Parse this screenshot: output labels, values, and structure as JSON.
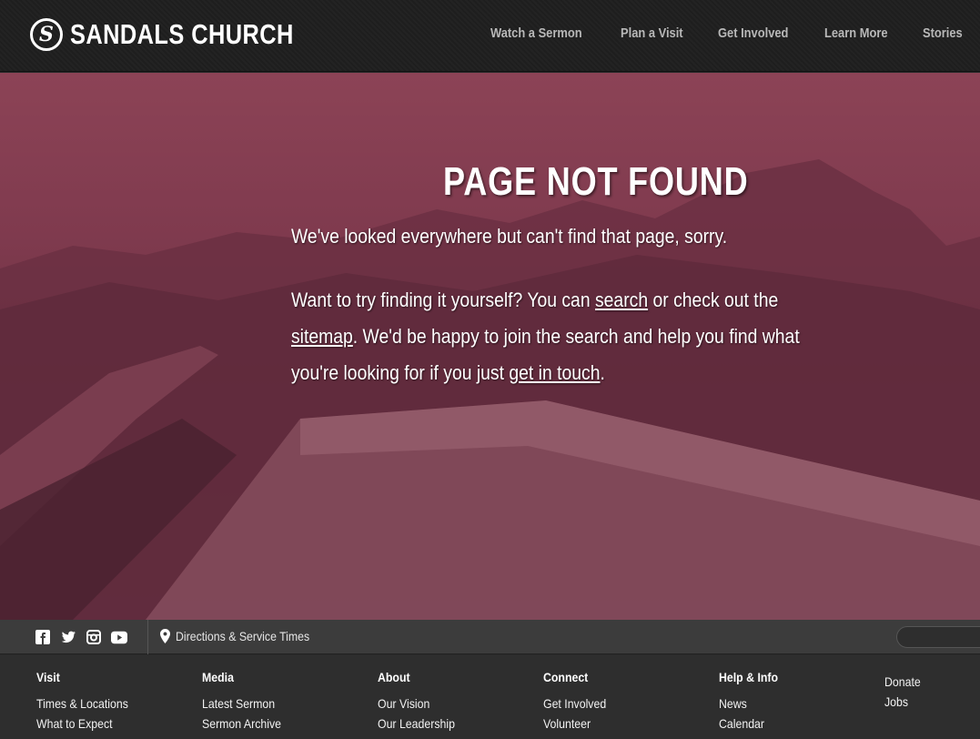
{
  "header": {
    "logo_text": "SANDALS CHURCH",
    "nav": [
      "Watch a Sermon",
      "Plan a Visit",
      "Get Involved",
      "Learn More",
      "Stories"
    ]
  },
  "hero": {
    "title": "PAGE NOT FOUND",
    "line1": "We've looked everywhere but can't find that page, sorry.",
    "p2_part1": "Want to try finding it yourself? You can ",
    "p2_link_search": "search",
    "p2_part2": " or check out the ",
    "p2_link_sitemap": "sitemap",
    "p2_part3": ". We'd be happy to join the search and help you find what you're looking for if you just ",
    "p2_link_contact": "get in touch",
    "p2_part4": "."
  },
  "subbar": {
    "social_icons": [
      "facebook-icon",
      "twitter-icon",
      "instagram-icon",
      "youtube-icon"
    ],
    "directions_label": "Directions & Service Times"
  },
  "footer": {
    "columns": [
      {
        "title": "Visit",
        "items": [
          "Times & Locations",
          "What to Expect"
        ]
      },
      {
        "title": "Media",
        "items": [
          "Latest Sermon",
          "Sermon Archive"
        ]
      },
      {
        "title": "About",
        "items": [
          "Our Vision",
          "Our Leadership"
        ]
      },
      {
        "title": "Connect",
        "items": [
          "Get Involved",
          "Volunteer"
        ]
      },
      {
        "title": "Help & Info",
        "items": [
          "News",
          "Calendar"
        ]
      }
    ],
    "extra": [
      "Donate",
      "Jobs"
    ]
  }
}
